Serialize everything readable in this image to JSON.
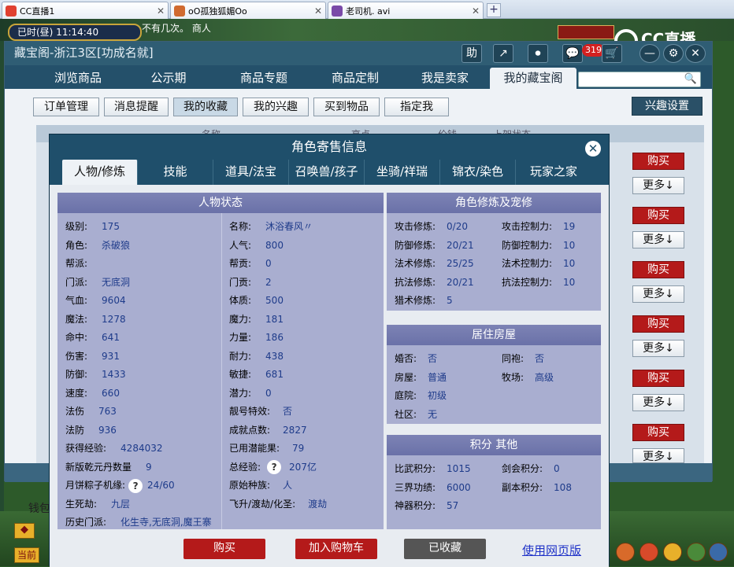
{
  "browser_tabs": [
    {
      "title": "CC直播1",
      "favicon_color": "#e04030"
    },
    {
      "title": "oO孤独狐媚Oo",
      "favicon_color": "#d06a30"
    },
    {
      "title": "老司机. avi",
      "favicon_color": "#7a4aa8"
    }
  ],
  "browser_new_tab": "+",
  "game": {
    "clock": "已时(昼) 11:14:40",
    "notice": "不有几次。 商人",
    "cc_logo": "CC直播",
    "hotkey_icons": [
      "◆",
      "当前"
    ]
  },
  "window": {
    "title": "藏宝阁-浙江3区[功成名就]",
    "title_icons": [
      "助",
      "↗",
      "⏺",
      "💬",
      "🛒",
      "—",
      "⚙",
      "✕"
    ],
    "message_badge": "319",
    "nav_tabs": [
      "浏览商品",
      "公示期",
      "商品专题",
      "商品定制",
      "我是卖家",
      "我的藏宝阁"
    ],
    "nav_active": "我的藏宝阁",
    "search_placeholder": "",
    "sub_tabs": [
      "订单管理",
      "消息提醒",
      "我的收藏",
      "我的兴趣",
      "买到物品",
      "指定我"
    ],
    "sub_active": "我的收藏",
    "interest_button": "兴趣设置",
    "list_header_fragments": [
      "名称",
      "亮点",
      "价钱",
      "上架状态"
    ],
    "buy_label": "购买",
    "more_label": "更多↓",
    "wallet_label": "钱包"
  },
  "modal": {
    "title": "角色寄售信息",
    "tabs": [
      "人物/修炼",
      "技能",
      "道具/法宝",
      "召唤兽/孩子",
      "坐骑/祥瑞",
      "锦衣/染色",
      "玩家之家"
    ],
    "active_tab": "人物/修炼",
    "status_panel": {
      "title": "人物状态",
      "left_rows": [
        {
          "label": "级别:",
          "value": "175"
        },
        {
          "label": "角色:",
          "value": "杀破狼"
        },
        {
          "label": "帮派:",
          "value": ""
        },
        {
          "label": "门派:",
          "value": "无底洞"
        },
        {
          "label": "气血:",
          "value": "9604"
        },
        {
          "label": "魔法:",
          "value": "1278"
        },
        {
          "label": "命中:",
          "value": "641"
        },
        {
          "label": "伤害:",
          "value": "931"
        },
        {
          "label": "防御:",
          "value": "1433"
        },
        {
          "label": "速度:",
          "value": "660"
        },
        {
          "label": "法伤",
          "value": "763"
        },
        {
          "label": "法防",
          "value": "936"
        },
        {
          "label": "获得经验:",
          "value": "4284032"
        },
        {
          "label": "新版乾元丹数量",
          "value": "9"
        },
        {
          "label": "月饼粽子机缘:",
          "value": "24/60"
        },
        {
          "label": "生死劫:",
          "value": "九层"
        },
        {
          "label": "历史门派:",
          "value": "化生寺,无底洞,魔王寨"
        }
      ],
      "right_rows": [
        {
          "label": "名称:",
          "value": "沐浴春风〃"
        },
        {
          "label": "人气:",
          "value": "800"
        },
        {
          "label": "帮贡:",
          "value": "0"
        },
        {
          "label": "门贡:",
          "value": "2"
        },
        {
          "label": "体质:",
          "value": "500"
        },
        {
          "label": "魔力:",
          "value": "181"
        },
        {
          "label": "力量:",
          "value": "186"
        },
        {
          "label": "耐力:",
          "value": "438"
        },
        {
          "label": "敏捷:",
          "value": "681"
        },
        {
          "label": "潜力:",
          "value": "0"
        },
        {
          "label": "靓号特效:",
          "value": "否"
        },
        {
          "label": "成就点数:",
          "value": "2827"
        },
        {
          "label": "已用潜能果:",
          "value": "79"
        },
        {
          "label": "总经验:",
          "value": "207亿"
        },
        {
          "label": "原始种族:",
          "value": "人"
        },
        {
          "label": "飞升/渡劫/化圣:",
          "value": "渡劫"
        }
      ]
    },
    "cultivation_panel": {
      "title": "角色修炼及宠修",
      "rows": [
        {
          "l1": "攻击修炼:",
          "v1": "0/20",
          "l2": "攻击控制力:",
          "v2": "19"
        },
        {
          "l1": "防御修炼:",
          "v1": "20/21",
          "l2": "防御控制力:",
          "v2": "10"
        },
        {
          "l1": "法术修炼:",
          "v1": "25/25",
          "l2": "法术控制力:",
          "v2": "10"
        },
        {
          "l1": "抗法修炼:",
          "v1": "20/21",
          "l2": "抗法控制力:",
          "v2": "10"
        },
        {
          "l1": "猎术修炼:",
          "v1": "5",
          "l2": "",
          "v2": ""
        }
      ]
    },
    "house_panel": {
      "title": "居住房屋",
      "rows": [
        {
          "l1": "婚否:",
          "v1": "否",
          "l2": "同袍:",
          "v2": "否"
        },
        {
          "l1": "房屋:",
          "v1": "普通",
          "l2": "牧场:",
          "v2": "高级"
        },
        {
          "l1": "庭院:",
          "v1": "初级",
          "l2": "",
          "v2": ""
        },
        {
          "l1": "社区:",
          "v1": "无",
          "l2": "",
          "v2": ""
        }
      ]
    },
    "score_panel": {
      "title": "积分 其他",
      "rows": [
        {
          "l1": "比武积分:",
          "v1": "1015",
          "l2": "剑会积分:",
          "v2": "0"
        },
        {
          "l1": "三界功绩:",
          "v1": "6000",
          "l2": "副本积分:",
          "v2": "108"
        },
        {
          "l1": "神器积分:",
          "v1": "57",
          "l2": "",
          "v2": ""
        }
      ]
    },
    "footer": {
      "buy": "购买",
      "add_cart": "加入购物车",
      "collected": "已收藏",
      "web_version": "使用网页版"
    }
  },
  "colors": {
    "accent_dark": "#1f4f6b",
    "buy_red": "#b41a1a",
    "panel_header": "#7077ac",
    "value_blue": "#1e3b8a",
    "link_blue": "#2033c8"
  }
}
